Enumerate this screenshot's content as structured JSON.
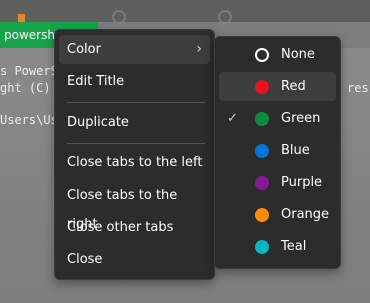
{
  "terminal": {
    "tab_title": "powershe",
    "lines": [
      "s PowerS",
      "ght (C) ",
      "Users\\Us"
    ],
    "right_text": "res"
  },
  "menu": {
    "items": [
      {
        "label": "Color",
        "has_submenu": true,
        "active": true
      },
      {
        "label": "Edit Title"
      },
      {
        "label": "Duplicate"
      },
      {
        "label": "Close tabs to the left"
      },
      {
        "label": "Close tabs to the right"
      },
      {
        "label": "Close other tabs"
      },
      {
        "label": "Close"
      }
    ],
    "submenu_glyph": "›"
  },
  "color_submenu": {
    "items": [
      {
        "label": "None",
        "color": "none"
      },
      {
        "label": "Red",
        "color": "#e81123",
        "active": true
      },
      {
        "label": "Green",
        "color": "#10893e",
        "checked": true
      },
      {
        "label": "Blue",
        "color": "#0078d7"
      },
      {
        "label": "Purple",
        "color": "#881798"
      },
      {
        "label": "Orange",
        "color": "#ff8c00"
      },
      {
        "label": "Teal",
        "color": "#00b7c3"
      }
    ],
    "check_glyph": "✓"
  }
}
